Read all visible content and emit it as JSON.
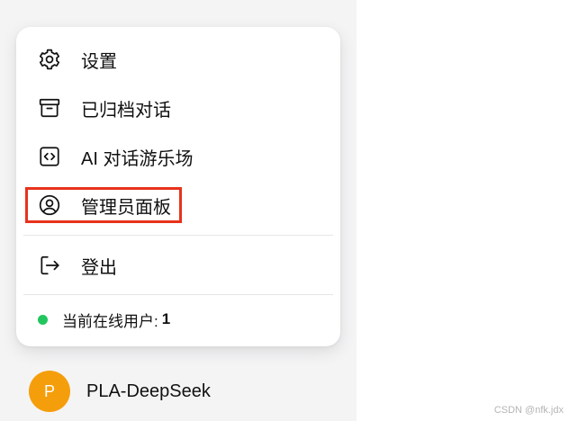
{
  "menu": {
    "items": [
      {
        "label": "设置",
        "icon": "gear-icon"
      },
      {
        "label": "已归档对话",
        "icon": "archive-icon"
      },
      {
        "label": "AI 对话游乐场",
        "icon": "code-icon"
      },
      {
        "label": "管理员面板",
        "icon": "user-circle-icon"
      },
      {
        "label": "登出",
        "icon": "logout-icon"
      }
    ],
    "online_label": "当前在线用户:",
    "online_count": "1"
  },
  "user": {
    "avatar_initial": "P",
    "name": "PLA-DeepSeek"
  },
  "watermark": "CSDN @nfk.jdx",
  "colors": {
    "status_dot": "#22c55e",
    "avatar": "#f59e0b",
    "highlight_border": "#e8321c"
  }
}
